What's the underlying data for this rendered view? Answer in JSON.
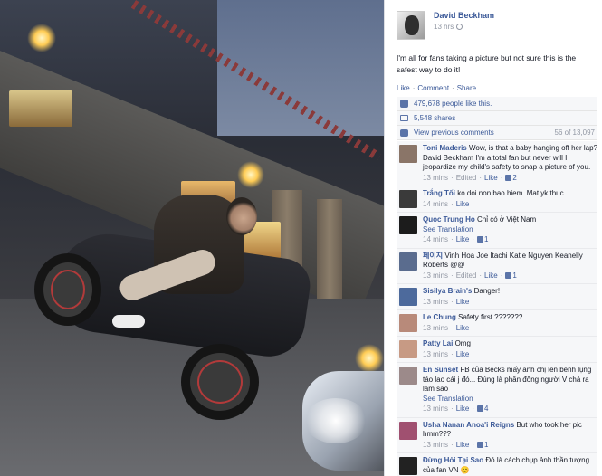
{
  "post": {
    "author": "David Beckham",
    "time": "13 hrs",
    "text": "I'm all for fans taking a picture but not sure this is the safest way to do it!",
    "actions": {
      "like": "Like",
      "comment": "Comment",
      "share": "Share",
      "separator": "·"
    },
    "likes_text": "479,678 people like this.",
    "shares_text": "5,548 shares",
    "view_previous": "View previous comments",
    "comment_count": "56 of 13,097"
  },
  "comments": [
    {
      "name": "Toni Maderis",
      "text": "Wow, is that a baby hanging off her lap? David Beckham I'm a total fan but never will I jeopardize my child's safety to snap a picture of you.",
      "time": "13 mins",
      "extra": "Edited",
      "like": "Like",
      "likes": "2",
      "avatar_color": "#8a7568"
    },
    {
      "name": "Trắng Tối",
      "text": "ko doi non bao hiem. Mat yk thuc",
      "time": "14 mins",
      "like": "Like",
      "avatar_color": "#3a3a3a"
    },
    {
      "name": "Quoc Trung Ho",
      "text": "Chỉ có ở Việt Nam",
      "translate": "See Translation",
      "time": "14 mins",
      "like": "Like",
      "likes": "1",
      "avatar_color": "#1c1c1c"
    },
    {
      "name": "페이지",
      "text": "Vinh Hoa Joe Itachi Katie Nguyen Keanelly Roberts @@",
      "time": "13 mins",
      "extra": "Edited",
      "like": "Like",
      "likes": "1",
      "avatar_color": "#5a6c8e"
    },
    {
      "name": "Sisilya Brain's",
      "text": "Danger!",
      "time": "13 mins",
      "like": "Like",
      "avatar_color": "#4d6a9c"
    },
    {
      "name": "Le Chung",
      "text": "Safety first ???????",
      "time": "13 mins",
      "like": "Like",
      "avatar_color": "#b88a7a"
    },
    {
      "name": "Patty Lai",
      "text": "Omg",
      "time": "13 mins",
      "like": "Like",
      "avatar_color": "#c79a84"
    },
    {
      "name": "En Sunset",
      "text": "FB của Becks mấy anh chị lên bênh lụng táo lao cái j đó... Đúng là phần đông người V chả ra làm sao",
      "translate": "See Translation",
      "time": "13 mins",
      "like": "Like",
      "likes": "4",
      "avatar_color": "#9c8a8a"
    },
    {
      "name": "Usha Nanan Anoa'i Reigns",
      "text": "But who took her pic hmm???",
      "time": "13 mins",
      "like": "Like",
      "likes": "1",
      "avatar_color": "#a05070"
    },
    {
      "name": "Đừng Hỏi Tại Sao",
      "text": "Đó là cách chụp ảnh thần tượng của fan VN 😊",
      "time": "",
      "like": "",
      "avatar_color": "#222222"
    }
  ]
}
